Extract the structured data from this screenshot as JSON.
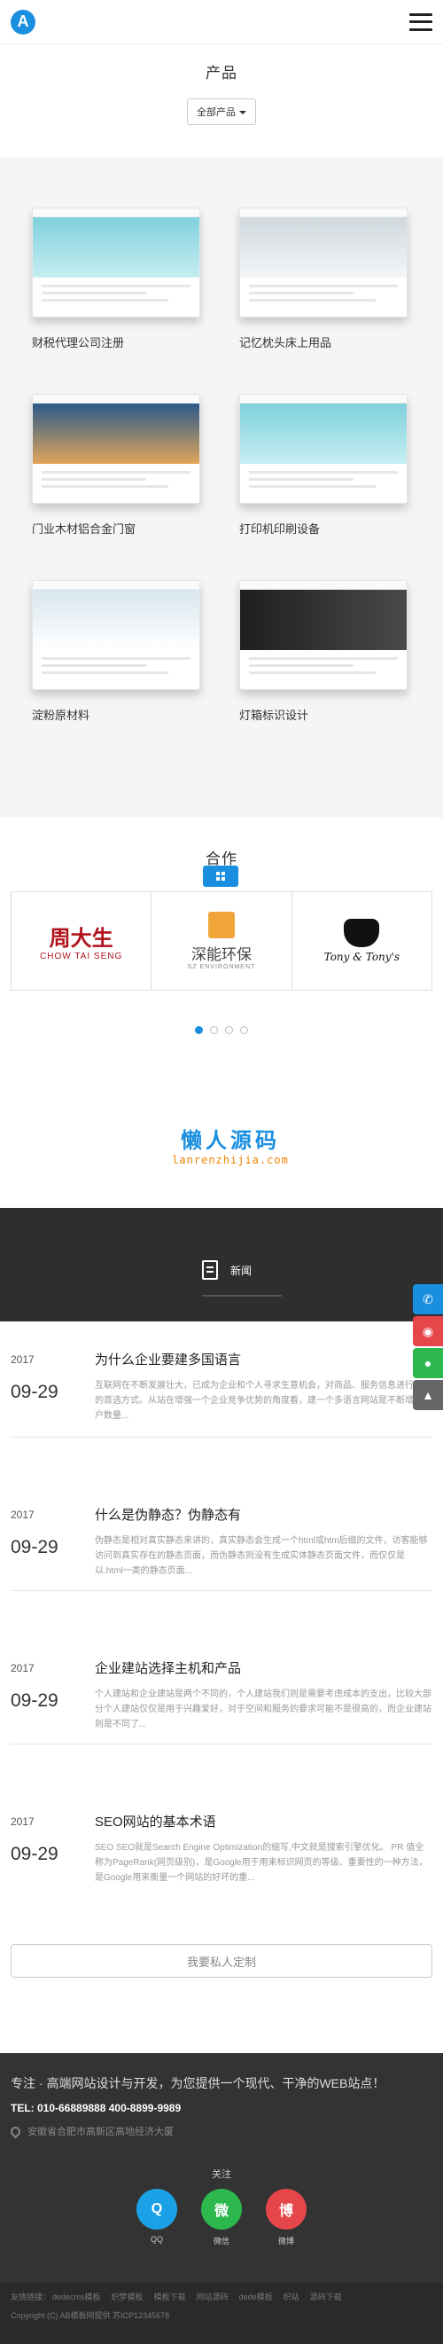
{
  "header": {
    "logo_letter": "A",
    "menu_icon": "hamburger-menu-icon"
  },
  "products": {
    "title": "产品",
    "filter_label": "全部产品",
    "items": [
      {
        "label": "财税代理公司注册",
        "theme": "cake"
      },
      {
        "label": "记忆枕头床上用品",
        "theme": "house"
      },
      {
        "label": "门业木材铝合金门窗",
        "theme": "travel"
      },
      {
        "label": "打印机印刷设备",
        "theme": "cake"
      },
      {
        "label": "淀粉原材料",
        "theme": "wedding"
      },
      {
        "label": "灯箱标识设计",
        "theme": "vr"
      }
    ],
    "more_icon": "grid-icon"
  },
  "partners": {
    "title": "合作",
    "logos": [
      {
        "name_cn": "周大生",
        "name_en": "CHOW TAI SENG"
      },
      {
        "name_cn": "深能环保",
        "name_en": "SZ ENVIRONMENT"
      },
      {
        "name_cn": "",
        "name_en": "Tony & Tony's"
      }
    ],
    "pager_count": 4,
    "pager_active": 0
  },
  "watermark": {
    "cn": "懒人源码",
    "en": "lanrenzhijia.com"
  },
  "news": {
    "title": "新闻",
    "tab_label": "新闻",
    "items": [
      {
        "year": "2017",
        "date": "09-29",
        "title": "为什么企业要建多国语言",
        "desc": "互联网在不断发展壮大，已成为企业和个人寻求生意机会，对商品、服务信息进行了解的首选方式。从站在增强一个企业竞争优势的角度看，建一个多语言网站是不断增加客户数量..."
      },
      {
        "year": "2017",
        "date": "09-29",
        "title": "什么是伪静态？伪静态有",
        "desc": "伪静态是相对真实静态来讲的，真实静态会生成一个html或htm后缀的文件，访客能够访问到真实存在的静态页面，而伪静态则没有生成实体静态页面文件，而仅仅是以.html一类的静态页面..."
      },
      {
        "year": "2017",
        "date": "09-29",
        "title": "企业建站选择主机和产品",
        "desc": "个人建站和企业建站是两个不同的，个人建站我们则是需要考虑成本的支出，比较大部分个人建站仅仅是用于兴趣爱好，对于空间和服务的要求可能不是很高的，而企业建站则是不同了..."
      },
      {
        "year": "2017",
        "date": "09-29",
        "title": "SEO网站的基本术语",
        "desc": "SEO SEO就是Search Engine Optimization的缩写,中文就是搜索引擎优化。 PR 值全称为PageRank(网页级别)，是Google用于用来标识网页的等级、重要性的一种方法，是Google用来衡量一个网站的好坏的重..."
      }
    ],
    "custom_button": "我要私人定制"
  },
  "side_tools": [
    "phone-icon",
    "weibo-icon",
    "wechat-icon",
    "back-to-top-icon"
  ],
  "footer": {
    "slogan": "专注 · 高端网站设计与开发，为您提供一个现代、干净的WEB站点！",
    "tel": "TEL: 010-66889888 400-8899-9989",
    "address": "安徽省合肥市高新区高地经济大厦",
    "follow_label": "关注",
    "social": [
      {
        "name": "QQ",
        "glyph": "Q",
        "color": "#1ba1e6"
      },
      {
        "name": "微信",
        "glyph": "微",
        "color": "#2db84d"
      },
      {
        "name": "微博",
        "glyph": "博",
        "color": "#e6464a"
      }
    ],
    "links_label": "友情链接：",
    "links": [
      "dedecms模板",
      "织梦模板",
      "模板下载",
      "网站源码",
      "dede模板",
      "织站",
      "源码下载"
    ],
    "copyright": "Copyright (C) AB模板网提供 苏ICP12345678"
  }
}
